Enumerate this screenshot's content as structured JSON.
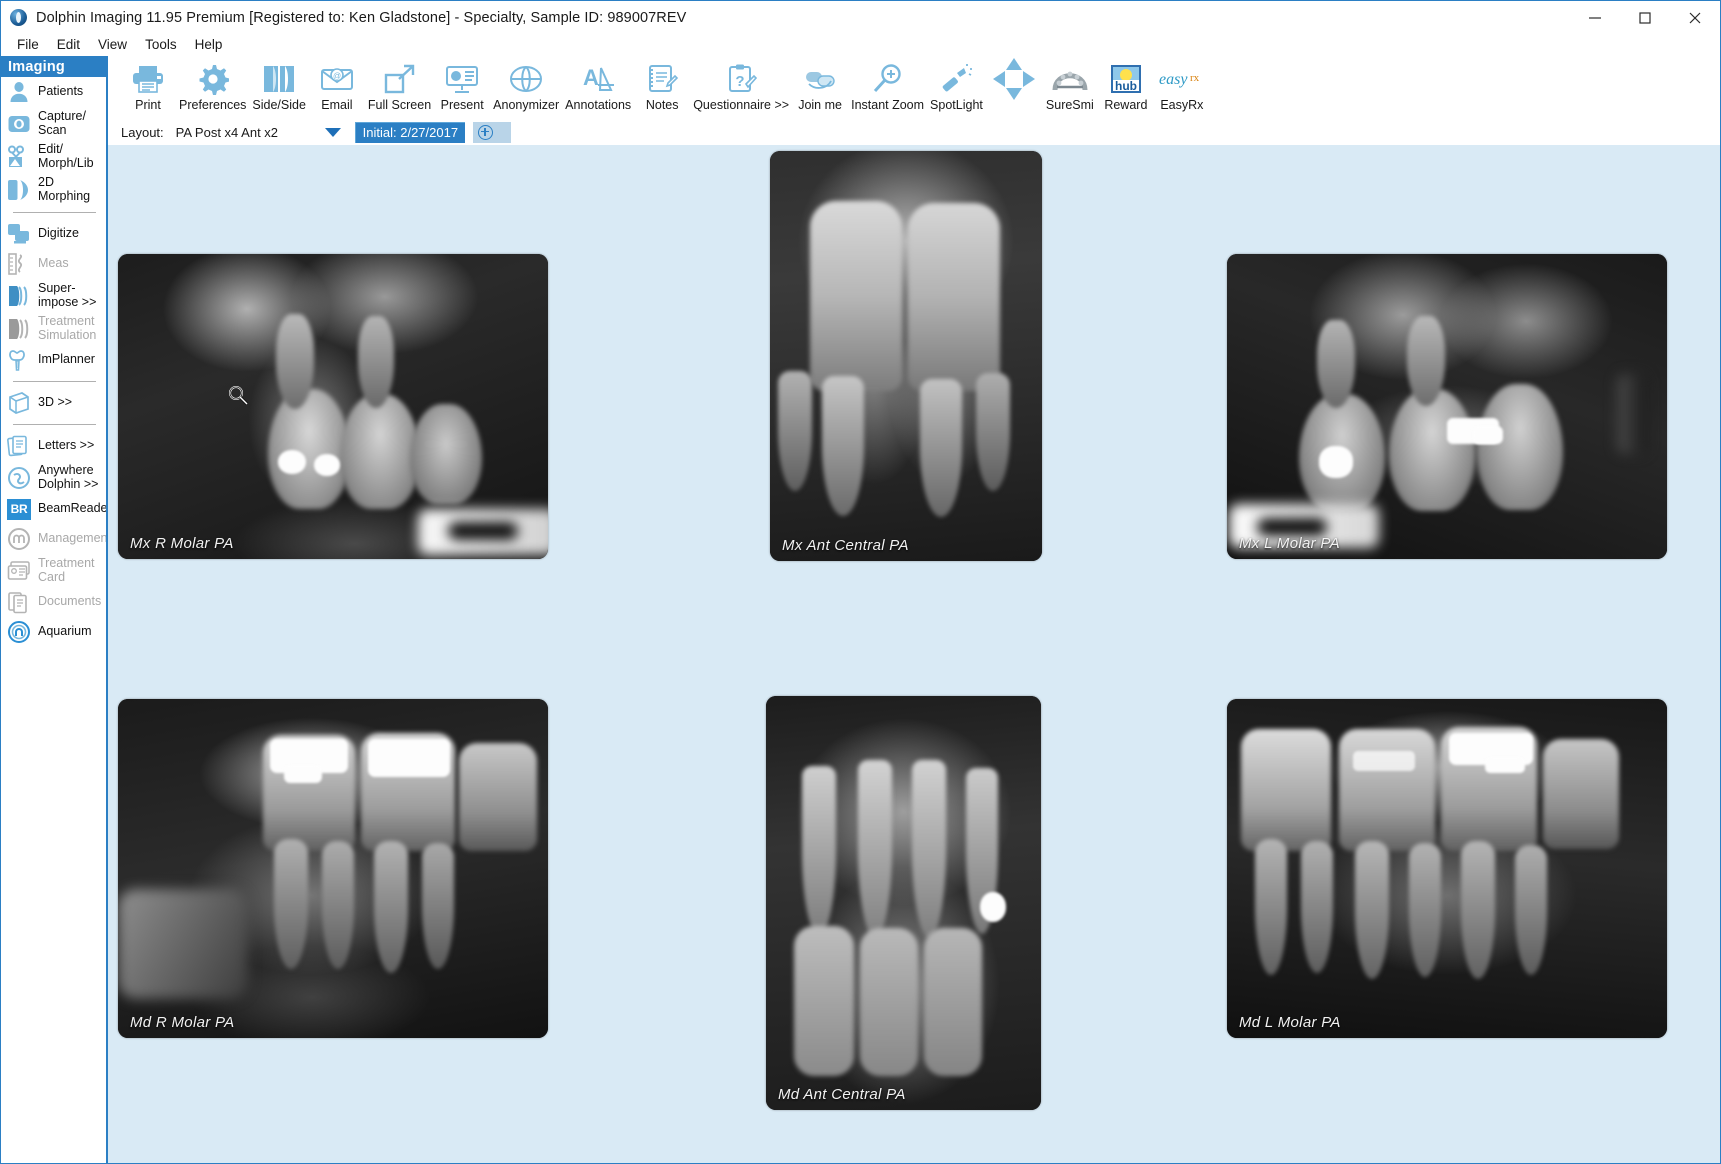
{
  "window": {
    "title": "Dolphin Imaging 11.95 Premium [Registered to: Ken Gladstone] - Specialty, Sample  ID: 989007REV",
    "logo_icon": "dolphin-logo-icon",
    "minimize_label": "─",
    "maximize_label": "□",
    "close_label": "✕"
  },
  "menu": {
    "items": [
      {
        "label": "File"
      },
      {
        "label": "Edit"
      },
      {
        "label": "View"
      },
      {
        "label": "Tools"
      },
      {
        "label": "Help"
      }
    ]
  },
  "sidebar": {
    "header": "Imaging",
    "items": [
      {
        "label": "Patients",
        "icon": "person-icon",
        "disabled": false
      },
      {
        "label": "Capture/\nScan",
        "icon": "camera-icon",
        "disabled": false
      },
      {
        "label": "Edit/\nMorph/Lib",
        "icon": "scissors-icon",
        "disabled": false
      },
      {
        "label": "2D Morphing",
        "icon": "face-profile-icon",
        "disabled": false
      },
      {
        "label": "",
        "icon": "separator",
        "disabled": false
      },
      {
        "label": "Digitize",
        "icon": "digitize-icon",
        "disabled": false
      },
      {
        "label": "Meas",
        "icon": "ruler-icon",
        "disabled": true
      },
      {
        "label": "Super-\nimpose >>",
        "icon": "superimpose-icon",
        "disabled": false
      },
      {
        "label": "Treatment\nSimulation",
        "icon": "treatment-sim-icon",
        "disabled": true
      },
      {
        "label": "ImPlanner",
        "icon": "implant-icon",
        "disabled": false
      },
      {
        "label": "",
        "icon": "separator",
        "disabled": false
      },
      {
        "label": "3D >>",
        "icon": "cube-icon",
        "disabled": false
      },
      {
        "label": "",
        "icon": "separator",
        "disabled": false
      },
      {
        "label": "Letters >>",
        "icon": "letters-icon",
        "disabled": false
      },
      {
        "label": "Anywhere\nDolphin >>",
        "icon": "anywhere-dolphin-icon",
        "disabled": false
      },
      {
        "label": "BeamReaders",
        "icon": "beamreaders-icon",
        "disabled": false
      },
      {
        "label": "Management",
        "icon": "management-icon",
        "disabled": true
      },
      {
        "label": "Treatment\nCard",
        "icon": "treatment-card-icon",
        "disabled": true
      },
      {
        "label": "Documents",
        "icon": "documents-icon",
        "disabled": true
      },
      {
        "label": "Aquarium",
        "icon": "aquarium-icon",
        "disabled": false
      }
    ]
  },
  "toolbar": {
    "buttons": [
      {
        "label": "Print",
        "icon": "printer-icon"
      },
      {
        "label": "Preferences",
        "icon": "gear-icon"
      },
      {
        "label": "Side/Side",
        "icon": "side-by-side-icon"
      },
      {
        "label": "Email",
        "icon": "email-icon"
      },
      {
        "label": "Full Screen",
        "icon": "fullscreen-icon"
      },
      {
        "label": "Present",
        "icon": "presentation-icon"
      },
      {
        "label": "Anonymizer",
        "icon": "anonymizer-mask-icon"
      },
      {
        "label": "Annotations",
        "icon": "annotations-icon"
      },
      {
        "label": "Notes",
        "icon": "notes-icon"
      },
      {
        "label": "Questionnaire >>",
        "icon": "questionnaire-icon"
      },
      {
        "label": "Join me",
        "icon": "join-me-icon"
      },
      {
        "label": "Instant Zoom",
        "icon": "magnifier-plus-icon"
      },
      {
        "label": "SpotLight",
        "icon": "flashlight-icon"
      },
      {
        "label": "",
        "icon": "four-arrows-icon"
      },
      {
        "label": "SureSmi",
        "icon": "suresmile-arch-icon"
      },
      {
        "label": "Reward",
        "icon": "hub-reward-icon"
      },
      {
        "label": "EasyRx",
        "icon": "easyrx-icon"
      }
    ]
  },
  "layout_bar": {
    "label": "Layout:",
    "selected_layout": "PA Post x4 Ant x2",
    "dropdown_icon": "chevron-down-icon",
    "timepoint_tab": "Initial: 2/27/2017",
    "add_tab_icon": "plus-circle-icon"
  },
  "canvas": {
    "cursor_icon": "magnifier-cursor-icon",
    "images": [
      {
        "caption": "Mx R Molar PA",
        "position": "top-left"
      },
      {
        "caption": "Mx Ant Central PA",
        "position": "top-center"
      },
      {
        "caption": "Mx L Molar PA",
        "position": "top-right"
      },
      {
        "caption": "Md R Molar PA",
        "position": "bottom-left"
      },
      {
        "caption": "Md Ant Central PA",
        "position": "bottom-center"
      },
      {
        "caption": "Md L Molar PA",
        "position": "bottom-right"
      }
    ]
  },
  "colors": {
    "accent": "#2b7fc4",
    "icon_blue": "#79b8dd",
    "canvas_bg": "#d9eaf5",
    "disabled_gray": "#a8a8a8"
  }
}
